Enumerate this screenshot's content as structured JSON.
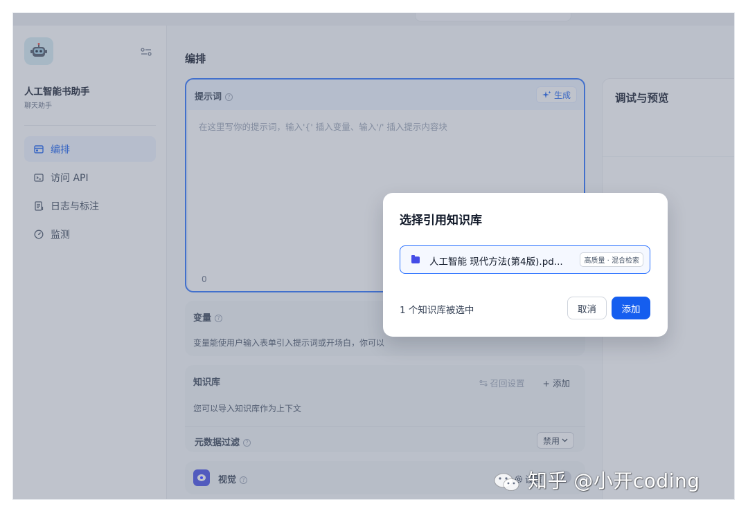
{
  "sidebar": {
    "app_name": "人工智能书助手",
    "app_type": "聊天助手",
    "nav": [
      {
        "label": "编排",
        "icon": "layout-icon",
        "active": true
      },
      {
        "label": "访问 API",
        "icon": "terminal-icon",
        "active": false
      },
      {
        "label": "日志与标注",
        "icon": "document-icon",
        "active": false
      },
      {
        "label": "监测",
        "icon": "gauge-icon",
        "active": false
      }
    ]
  },
  "main": {
    "title": "编排",
    "prompt": {
      "label": "提示词",
      "generate_label": "生成",
      "placeholder": "在这里写你的提示词，输入'{' 插入变量、输入'/' 插入提示内容块",
      "char_count": "0"
    },
    "variables": {
      "label": "变量",
      "description": "变量能使用户输入表单引入提示词或开场白，你可以"
    },
    "knowledge": {
      "label": "知识库",
      "recall_settings": "召回设置",
      "add_label": "+ 添加",
      "description": "您可以导入知识库作为上下文",
      "metadata_filter_label": "元数据过滤",
      "metadata_filter_value": "禁用"
    },
    "vision": {
      "label": "视觉",
      "settings_label": "设置"
    }
  },
  "debug": {
    "title": "调试与预览"
  },
  "modal": {
    "title": "选择引用知识库",
    "item_name": "人工智能 现代方法(第4版).pd...",
    "item_badge": "高质量 · 混合检索",
    "selected_text": "1 个知识库被选中",
    "cancel_label": "取消",
    "add_label": "添加"
  },
  "watermark": {
    "text": "知乎 @小开coding"
  },
  "colors": {
    "primary": "#155eef",
    "overlay": "#667085",
    "accent_icon": "#444ce7"
  }
}
